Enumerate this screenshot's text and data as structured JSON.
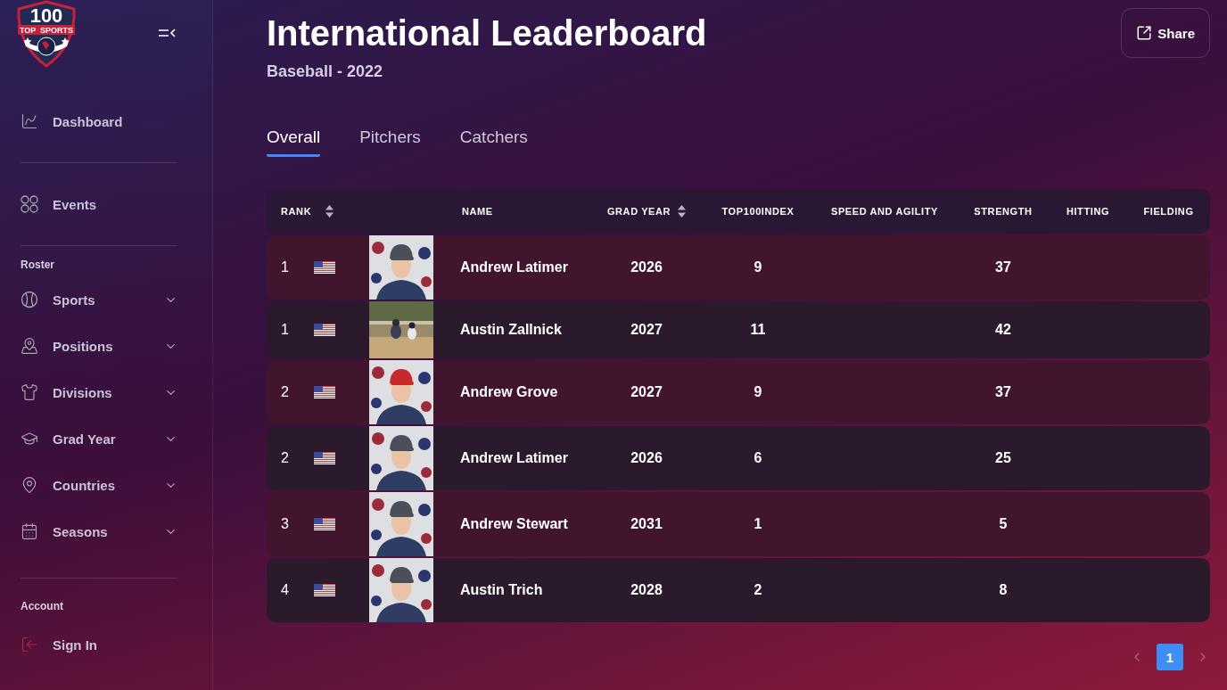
{
  "logo": {
    "left": "TOP",
    "number": "100",
    "right": "SPORTS"
  },
  "sidebar": {
    "top_items": [
      {
        "label": "Dashboard"
      },
      {
        "label": "Events"
      }
    ],
    "roster": {
      "heading": "Roster",
      "items": [
        {
          "label": "Sports",
          "expanded": false
        },
        {
          "label": "Positions",
          "expanded": false
        },
        {
          "label": "Divisions",
          "expanded": false
        },
        {
          "label": "Grad Year",
          "expanded": false
        },
        {
          "label": "Countries",
          "expanded": false
        },
        {
          "label": "Seasons",
          "expanded": false
        }
      ]
    },
    "account": {
      "heading": "Account",
      "items": [
        {
          "label": "Sign In"
        }
      ]
    }
  },
  "header": {
    "title": "International Leaderboard",
    "subtitle": "Baseball - 2022",
    "share": "Share"
  },
  "tabs": [
    {
      "label": "Overall",
      "selected": true
    },
    {
      "label": "Pitchers",
      "selected": false
    },
    {
      "label": "Catchers",
      "selected": false
    }
  ],
  "table": {
    "columns": [
      {
        "label": "RANK",
        "sortable": true
      },
      {
        "label": "NAME",
        "sortable": false
      },
      {
        "label": "GRAD YEAR",
        "sortable": true
      },
      {
        "label": "TOP100INDEX",
        "sortable": false
      },
      {
        "label": "SPEED AND AGILITY",
        "sortable": false
      },
      {
        "label": "STRENGTH",
        "sortable": false
      },
      {
        "label": "HITTING",
        "sortable": false
      },
      {
        "label": "FIELDING",
        "sortable": false
      }
    ],
    "rows": [
      {
        "rank": "1",
        "name": "Andrew Latimer",
        "grad_year": "2026",
        "top100index": "9",
        "strength": "37"
      },
      {
        "rank": "1",
        "name": "Austin Zallnick",
        "grad_year": "2027",
        "top100index": "11",
        "strength": "42"
      },
      {
        "rank": "2",
        "name": "Andrew Grove",
        "grad_year": "2027",
        "top100index": "9",
        "strength": "37"
      },
      {
        "rank": "2",
        "name": "Andrew Latimer",
        "grad_year": "2026",
        "top100index": "6",
        "strength": "25"
      },
      {
        "rank": "3",
        "name": "Andrew Stewart",
        "grad_year": "2031",
        "top100index": "1",
        "strength": "5"
      },
      {
        "rank": "4",
        "name": "Austin Trich",
        "grad_year": "2028",
        "top100index": "2",
        "strength": "8"
      }
    ]
  },
  "pagination": {
    "prev_disabled": true,
    "next_disabled": true,
    "pages": [
      {
        "label": "1",
        "selected": true
      }
    ]
  }
}
